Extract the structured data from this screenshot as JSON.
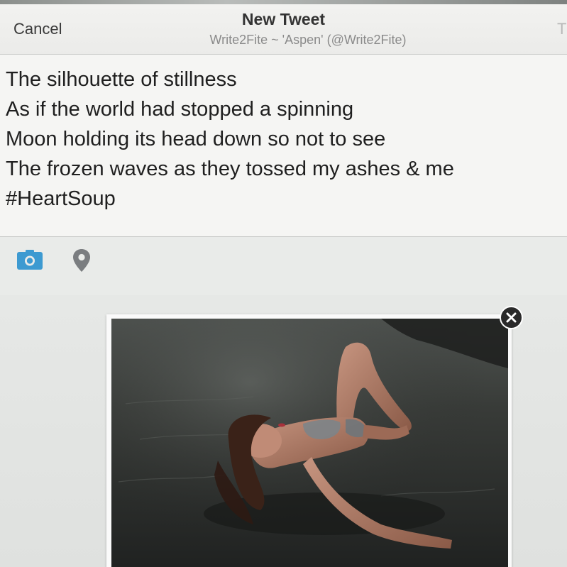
{
  "header": {
    "cancel_label": "Cancel",
    "title": "New Tweet",
    "account": "Write2Fite ~ 'Aspen' (@Write2Fite)",
    "tweet_button_partial": "T"
  },
  "compose": {
    "text": "The silhouette of stillness\nAs if the world had stopped a spinning\nMoon holding its head down so not to see\nThe frozen waves as they tossed my ashes & me\n#HeartSoup"
  },
  "toolbar": {
    "icons": [
      "camera-icon",
      "location-pin-icon"
    ],
    "accent_color": "#3d9ad1",
    "pin_color": "#7a7d80"
  },
  "attachment": {
    "remove_icon": "close-circle-icon"
  }
}
